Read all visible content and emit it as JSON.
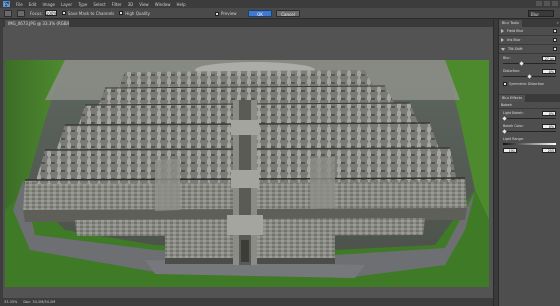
{
  "app": {
    "logo": "Ps"
  },
  "menu": [
    "File",
    "Edit",
    "Image",
    "Layer",
    "Type",
    "Select",
    "Filter",
    "3D",
    "View",
    "Window",
    "Help"
  ],
  "options": {
    "focus_label": "Focus:",
    "focus_value": "100%",
    "save_mask_label": "Save Mask to Channels",
    "high_quality_label": "High Quality",
    "preview_label": "Preview",
    "ok_label": "OK",
    "cancel_label": "Cancel",
    "workspace": "Blur Gallery"
  },
  "document": {
    "tab_title": "IMG_0673.JPG @ 33.3% (RGB/8)*"
  },
  "status": {
    "zoom": "33.33%",
    "doc_size": "Doc: 34.2M/34.2M"
  },
  "panel": {
    "tab_blur_tools": "Blur Tools",
    "field_blur": "Field Blur",
    "iris_blur": "Iris Blur",
    "tilt_shift": "Tilt-Shift",
    "blur_label": "Blur:",
    "blur_value": "27 px",
    "blur_knob": 0.35,
    "distortion_label": "Distortion:",
    "distortion_value": "0%",
    "distortion_knob": 0.5,
    "symmetric_label": "Symmetric Distortion",
    "tab_blur_effects": "Blur Effects",
    "bokeh_label": "Bokeh",
    "light_bokeh_label": "Light Bokeh:",
    "light_bokeh_value": "0%",
    "bokeh_color_label": "Bokeh Color:",
    "bokeh_color_value": "0%",
    "light_range_label": "Light Range:",
    "light_range_lo": "191",
    "light_range_hi": "255"
  },
  "colors": {
    "accent": "#3f7ad0",
    "grass": "#3f7a26",
    "stone": "#7c7c78",
    "path": "#6d6f72"
  }
}
